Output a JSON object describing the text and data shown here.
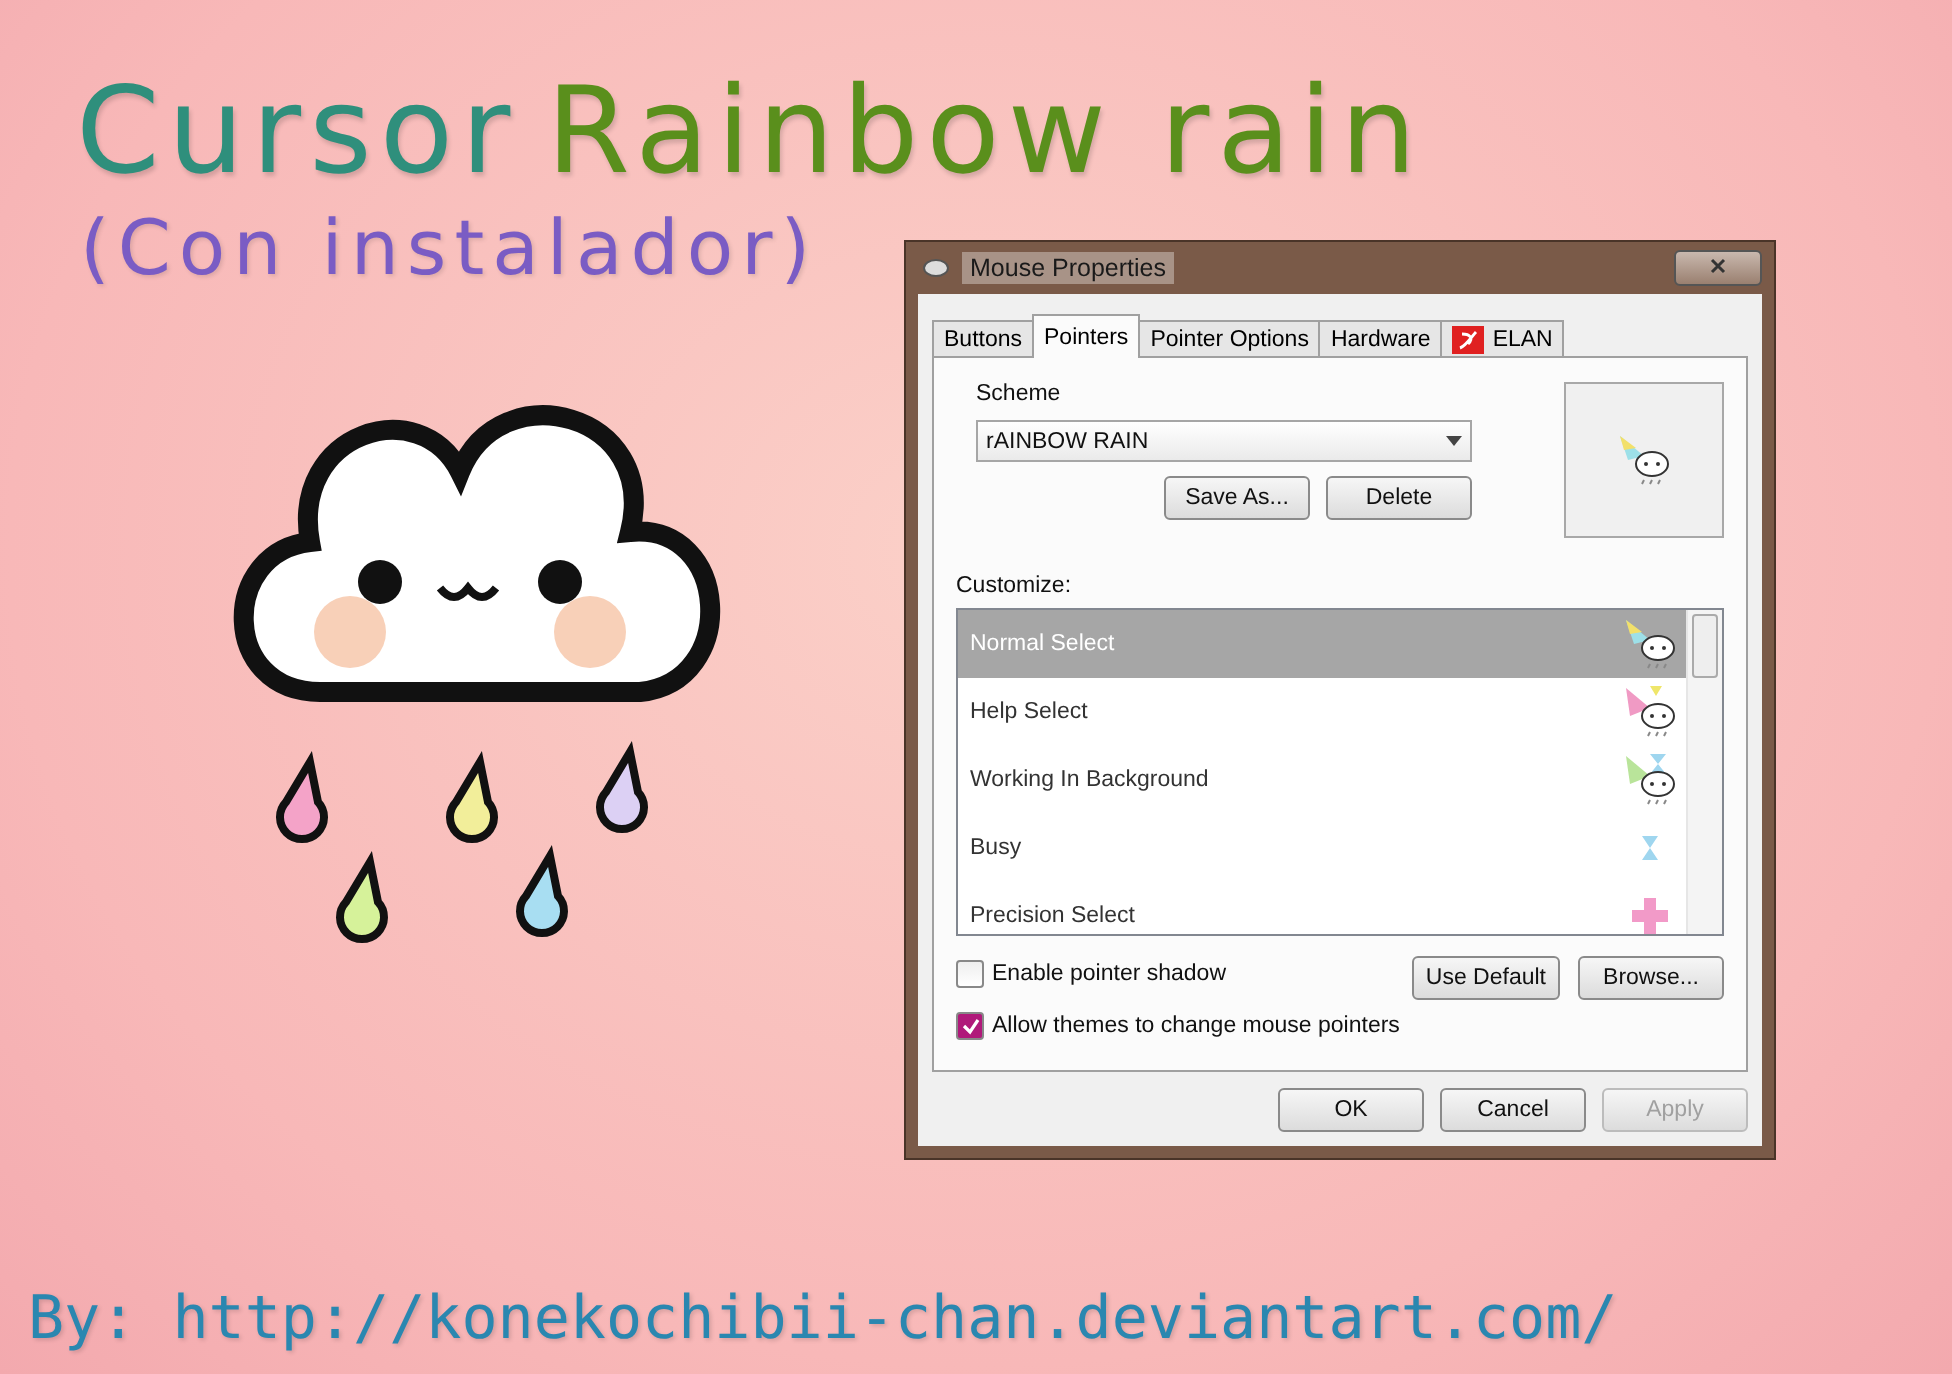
{
  "poster": {
    "title_first": "Cursor",
    "title_second": "Rainbow rain",
    "subtitle": "(Con instalador)",
    "credit": "By: http://konekochibii-chan.deviantart.com/"
  },
  "window": {
    "title": "Mouse Properties",
    "tabs": [
      {
        "label": "Buttons",
        "selected": false,
        "kind": "plain"
      },
      {
        "label": "Pointers",
        "selected": true,
        "kind": "plain"
      },
      {
        "label": "Pointer Options",
        "selected": false,
        "kind": "plain"
      },
      {
        "label": "Hardware",
        "selected": false,
        "kind": "plain"
      },
      {
        "label": "ELAN",
        "selected": false,
        "kind": "logo"
      }
    ],
    "scheme": {
      "label": "Scheme",
      "value": "rAINBOW RAIN",
      "buttons": [
        "Save As...",
        "Delete"
      ]
    },
    "customize": {
      "label": "Customize:",
      "items": [
        {
          "label": "Normal Select",
          "selected": true,
          "kind": "arrow"
        },
        {
          "label": "Help Select",
          "selected": false,
          "kind": "help"
        },
        {
          "label": "Working In Background",
          "selected": false,
          "kind": "working"
        },
        {
          "label": "Busy",
          "selected": false,
          "kind": "busy"
        },
        {
          "label": "Precision Select",
          "selected": false,
          "kind": "cross"
        }
      ],
      "buttons": [
        "Use Default",
        "Browse..."
      ]
    },
    "checkboxes": [
      {
        "label": "Enable pointer shadow",
        "checked": false
      },
      {
        "label": "Allow themes to change mouse pointers",
        "checked": true
      }
    ],
    "footer_buttons": [
      {
        "label": "OK",
        "disabled": false
      },
      {
        "label": "Cancel",
        "disabled": false
      },
      {
        "label": "Apply",
        "disabled": true
      }
    ]
  }
}
